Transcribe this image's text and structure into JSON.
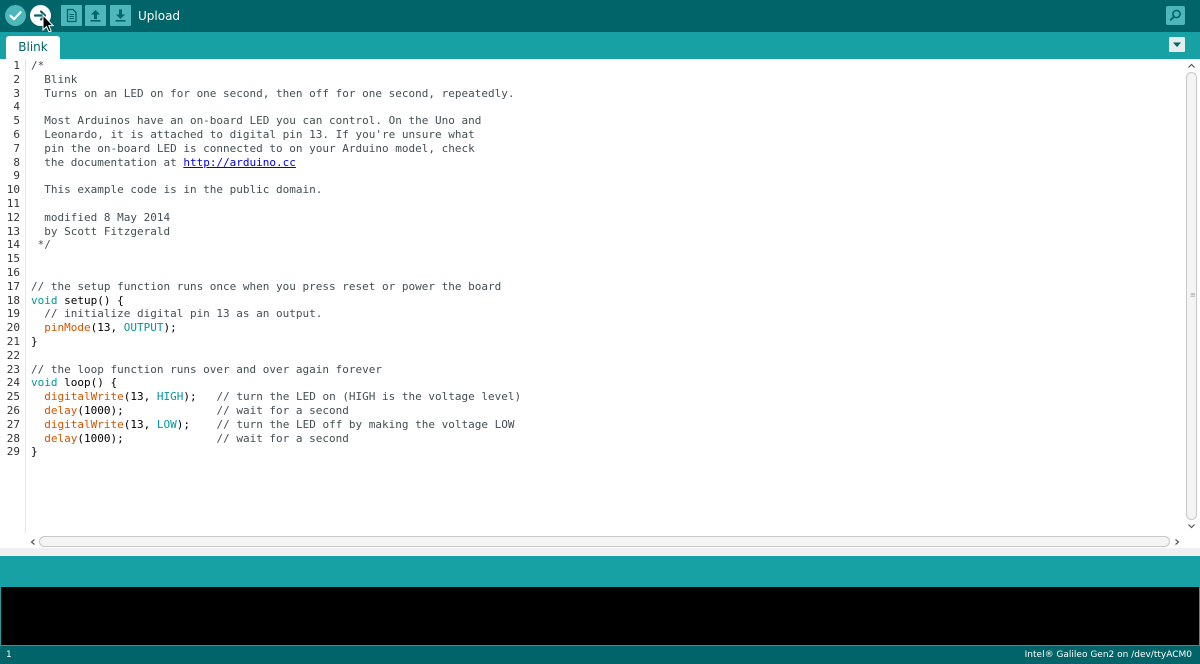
{
  "toolbar": {
    "verify_icon": "check-icon",
    "upload_icon": "arrow-right-icon",
    "new_icon": "new-file-icon",
    "open_icon": "arrow-up-icon",
    "save_icon": "arrow-down-icon",
    "hover_label": "Upload",
    "serial_monitor_icon": "magnifier-icon"
  },
  "tabs": [
    {
      "label": "Blink"
    }
  ],
  "editor": {
    "line_numbers": [
      "1",
      "2",
      "3",
      "4",
      "5",
      "6",
      "7",
      "8",
      "9",
      "10",
      "11",
      "12",
      "13",
      "14",
      "15",
      "16",
      "17",
      "18",
      "19",
      "20",
      "21",
      "22",
      "23",
      "24",
      "25",
      "26",
      "27",
      "28",
      "29"
    ],
    "code": {
      "l1": "/*",
      "l2": "  Blink",
      "l3": "  Turns on an LED on for one second, then off for one second, repeatedly.",
      "l5": "  Most Arduinos have an on-board LED you can control. On the Uno and",
      "l6": "  Leonardo, it is attached to digital pin 13. If you're unsure what",
      "l7": "  pin the on-board LED is connected to on your Arduino model, check",
      "l8_pre": "  the documentation at ",
      "l8_link": "http://arduino.cc",
      "l10": "  This example code is in the public domain.",
      "l12": "  modified 8 May 2014",
      "l13": "  by Scott Fitzgerald",
      "l14": " */",
      "l17": "// the setup function runs once when you press reset or power the board",
      "l18_kw": "void",
      "l18_rest": " setup() {",
      "l19": "  // initialize digital pin 13 as an output.",
      "l20_ind": "  ",
      "l20_fn": "pinMode",
      "l20_a": "(13, ",
      "l20_c": "OUTPUT",
      "l20_b": ");",
      "l21": "}",
      "l23": "// the loop function runs over and over again forever",
      "l24_kw": "void",
      "l24_rest": " loop() {",
      "l25_ind": "  ",
      "l25_fn": "digitalWrite",
      "l25_a": "(13, ",
      "l25_c": "HIGH",
      "l25_b": ");   ",
      "l25_cmt": "// turn the LED on (HIGH is the voltage level)",
      "l26_ind": "  ",
      "l26_fn": "delay",
      "l26_a": "(1000);              ",
      "l26_cmt": "// wait for a second",
      "l27_ind": "  ",
      "l27_fn": "digitalWrite",
      "l27_a": "(13, ",
      "l27_c": "LOW",
      "l27_b": ");    ",
      "l27_cmt": "// turn the LED off by making the voltage LOW",
      "l28_ind": "  ",
      "l28_fn": "delay",
      "l28_a": "(1000);              ",
      "l28_cmt": "// wait for a second",
      "l29": "}"
    }
  },
  "footer": {
    "line": "1",
    "board": "Intel® Galileo Gen2 on /dev/ttyACM0"
  },
  "colors": {
    "toolbar": "#006468",
    "tabbar": "#17a1a5",
    "button": "#4db7bb",
    "keyword": "#00979c",
    "function": "#d35400",
    "comment": "#434f54"
  }
}
